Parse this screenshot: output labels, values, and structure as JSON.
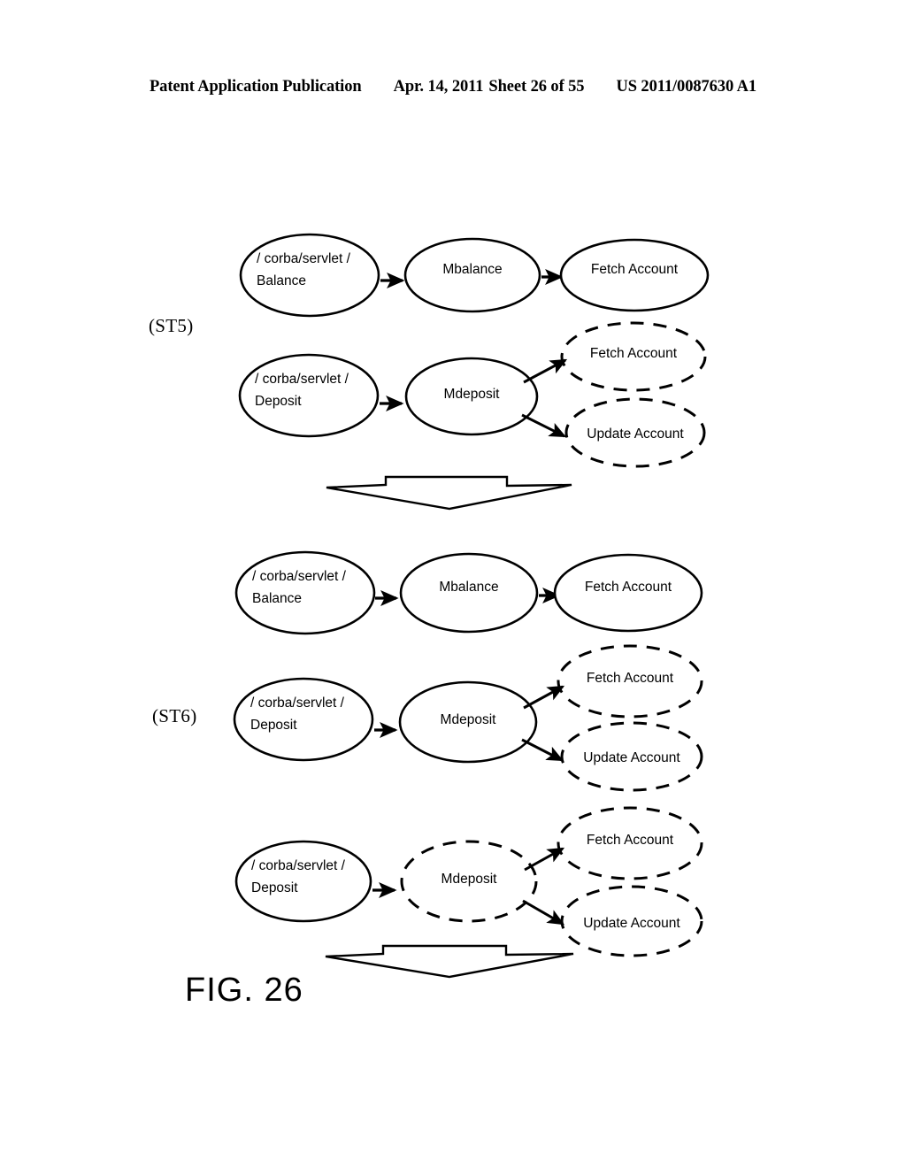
{
  "header": {
    "publication": "Patent Application Publication",
    "date": "Apr. 14, 2011",
    "sheet": "Sheet 26 of 55",
    "patent_number": "US 2011/0087630 A1"
  },
  "figure": {
    "caption": "FIG. 26",
    "steps": [
      {
        "id": "st5",
        "label": "(ST5)"
      },
      {
        "id": "st6",
        "label": "(ST6)"
      }
    ],
    "node_labels": {
      "servlet_balance_line1": "/ corba/servlet /",
      "servlet_balance_line2": "Balance",
      "servlet_deposit_line1": "/ corba/servlet /",
      "servlet_deposit_line2": "Deposit",
      "mbalance": "Mbalance",
      "mdeposit": "Mdeposit",
      "fetch_account": "Fetch Account",
      "update_account": "Update Account"
    }
  },
  "diagrams": {
    "st5": {
      "rows": [
        {
          "name": "balance-flow",
          "nodes": [
            {
              "label_line1": "/ corba/servlet /",
              "label_line2": "Balance",
              "style": "solid"
            },
            {
              "label_line1": "Mbalance",
              "style": "solid"
            },
            {
              "label_line1": "Fetch Account",
              "style": "solid"
            }
          ]
        },
        {
          "name": "deposit-flow",
          "nodes": [
            {
              "label_line1": "/ corba/servlet /",
              "label_line2": "Deposit",
              "style": "solid"
            },
            {
              "label_line1": "Mdeposit",
              "style": "solid"
            },
            {
              "label_line1": "Fetch Account",
              "style": "dashed"
            },
            {
              "label_line1": "Update Account",
              "style": "dashed"
            }
          ]
        }
      ]
    },
    "st6": {
      "rows": [
        {
          "name": "balance-flow",
          "nodes": [
            {
              "label_line1": "/ corba/servlet /",
              "label_line2": "Balance",
              "style": "solid"
            },
            {
              "label_line1": "Mbalance",
              "style": "solid"
            },
            {
              "label_line1": "Fetch Account",
              "style": "solid"
            }
          ]
        },
        {
          "name": "deposit-flow-solid-mdeposit",
          "nodes": [
            {
              "label_line1": "/ corba/servlet /",
              "label_line2": "Deposit",
              "style": "solid"
            },
            {
              "label_line1": "Mdeposit",
              "style": "solid"
            },
            {
              "label_line1": "Fetch Account",
              "style": "dashed"
            },
            {
              "label_line1": "Update Account",
              "style": "dashed"
            }
          ]
        },
        {
          "name": "deposit-flow-dashed-mdeposit",
          "nodes": [
            {
              "label_line1": "/ corba/servlet /",
              "label_line2": "Deposit",
              "style": "solid"
            },
            {
              "label_line1": "Mdeposit",
              "style": "dashed"
            },
            {
              "label_line1": "Fetch Account",
              "style": "dashed"
            },
            {
              "label_line1": "Update Account",
              "style": "dashed"
            }
          ]
        }
      ]
    }
  },
  "transitions": [
    {
      "name": "st5-to-st6-block-arrow",
      "direction": "down"
    },
    {
      "name": "st6-to-next-block-arrow",
      "direction": "down"
    }
  ],
  "colors": {
    "ink": "#000000",
    "paper": "#ffffff"
  }
}
